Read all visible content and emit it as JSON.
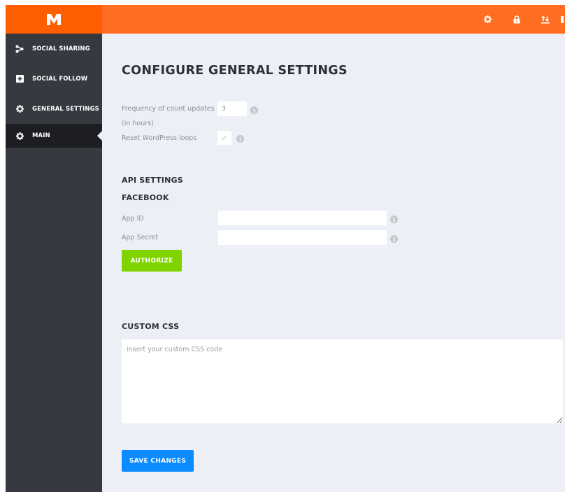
{
  "header": {
    "logo_letter": "M",
    "icons": [
      "gear-icon",
      "lock-icon",
      "import-export-icon",
      "partial-icon"
    ]
  },
  "sidebar": {
    "items": [
      {
        "label": "SOCIAL SHARING",
        "icon": "share-icon",
        "active": false
      },
      {
        "label": "SOCIAL FOLLOW",
        "icon": "plus-square-icon",
        "active": false
      },
      {
        "label": "GENERAL SETTINGS",
        "icon": "gear-icon",
        "active": false
      },
      {
        "label": "MAIN",
        "icon": "gear-icon",
        "active": true
      }
    ]
  },
  "main": {
    "title": "CONFIGURE GENERAL SETTINGS",
    "frequency": {
      "label": "Frequency of count updates",
      "sublabel": "(in hours)",
      "value": "3"
    },
    "reset_loops": {
      "label": "Reset WordPress loops",
      "checked": true
    },
    "api_settings_heading": "API SETTINGS",
    "facebook_heading": "FACEBOOK",
    "app_id": {
      "label": "App ID",
      "value": ""
    },
    "app_secret": {
      "label": "App Secret",
      "value": ""
    },
    "authorize_label": "AUTHORIZE",
    "custom_css_heading": "CUSTOM CSS",
    "custom_css_placeholder": "insert your custom CSS code",
    "save_label": "SAVE CHANGES"
  },
  "colors": {
    "header_orange": "#ff6d22",
    "logo_orange": "#ff5e00",
    "sidebar": "#363940",
    "sidebar_active": "#1d1e22",
    "content_bg": "#ecf0f6",
    "authorize_green": "#7fd400",
    "save_blue": "#0a8bff"
  }
}
